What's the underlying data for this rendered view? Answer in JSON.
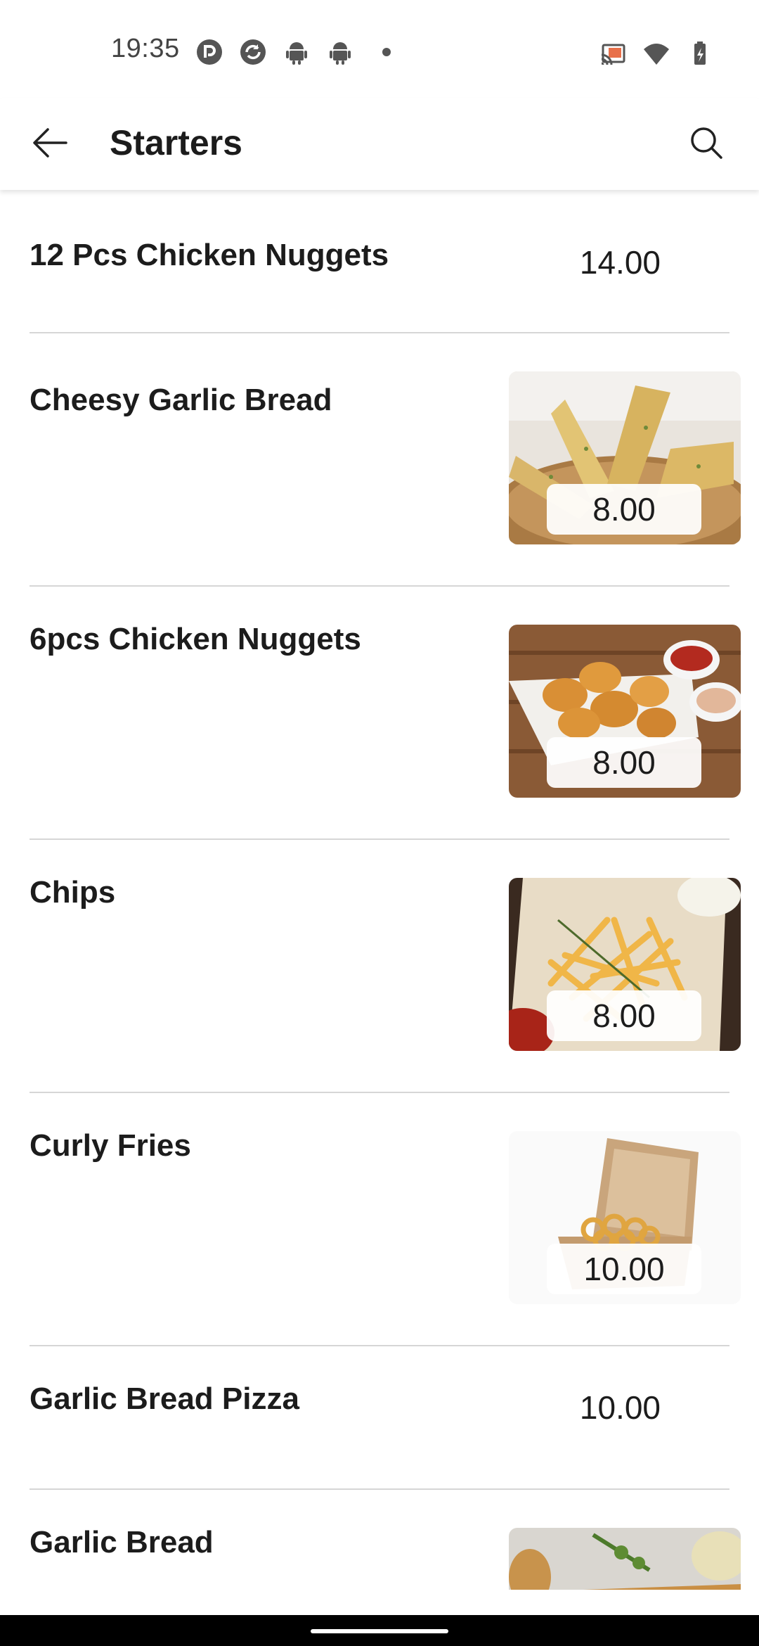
{
  "status_bar": {
    "time": "19:35",
    "left_icons": [
      "pocket-casts-icon",
      "sync-icon",
      "android-icon",
      "android-icon"
    ],
    "right_icons": [
      "cast-icon",
      "wifi-icon",
      "battery-icon"
    ]
  },
  "app_bar": {
    "title": "Starters",
    "back_icon": "arrow-back-icon",
    "search_icon": "search-icon"
  },
  "menu_items": [
    {
      "name": "12 Pcs Chicken Nuggets",
      "price": "14.00",
      "image": null
    },
    {
      "name": "Cheesy Garlic Bread",
      "price": "8.00",
      "image": "garlic-bread-photo"
    },
    {
      "name": "6pcs Chicken Nuggets",
      "price": "8.00",
      "image": "chicken-nuggets-photo"
    },
    {
      "name": "Chips",
      "price": "8.00",
      "image": "chips-photo"
    },
    {
      "name": "Curly Fries",
      "price": "10.00",
      "image": "curly-fries-photo"
    },
    {
      "name": "Garlic Bread Pizza",
      "price": "10.00",
      "image": null
    },
    {
      "name": "Garlic Bread",
      "price": "",
      "image": "garlic-bread-loaf-photo"
    }
  ],
  "colors": {
    "background": "#ffffff",
    "text": "#1c1c1c",
    "divider": "#d6d6d6"
  }
}
